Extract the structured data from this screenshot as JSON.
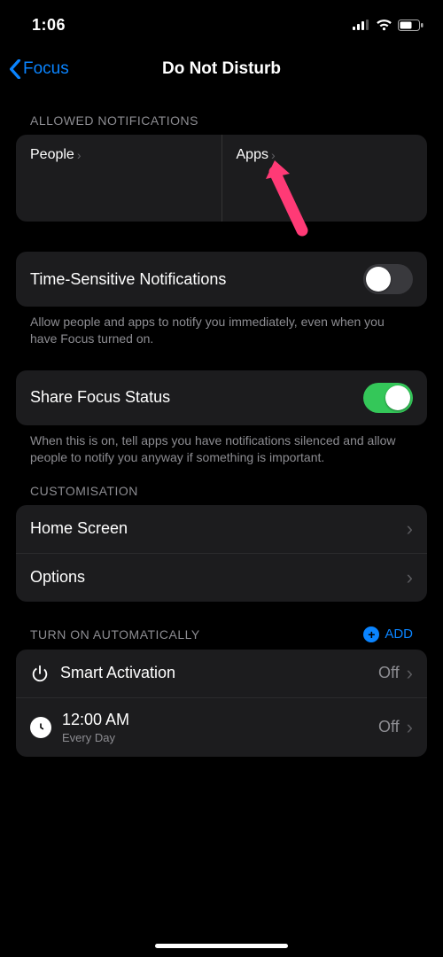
{
  "status": {
    "time": "1:06"
  },
  "nav": {
    "back_label": "Focus",
    "title": "Do Not Disturb"
  },
  "sections": {
    "allowed": {
      "header": "ALLOWED NOTIFICATIONS",
      "people": "People",
      "apps": "Apps"
    },
    "time_sensitive": {
      "title": "Time-Sensitive Notifications",
      "desc": "Allow people and apps to notify you immediately, even when you have Focus turned on.",
      "on": false
    },
    "share_status": {
      "title": "Share Focus Status",
      "desc": "When this is on, tell apps you have notifications silenced and allow people to notify you anyway if something is important.",
      "on": true
    },
    "customisation": {
      "header": "CUSTOMISATION",
      "home": "Home Screen",
      "options": "Options"
    },
    "auto": {
      "header": "TURN ON AUTOMATICALLY",
      "add": "ADD",
      "smart": {
        "title": "Smart Activation",
        "status": "Off"
      },
      "schedule": {
        "time": "12:00 AM",
        "repeat": "Every Day",
        "status": "Off"
      }
    }
  },
  "colors": {
    "accent": "#0a84ff",
    "toggle_on": "#34c759",
    "annotation": "#ff3a76"
  }
}
